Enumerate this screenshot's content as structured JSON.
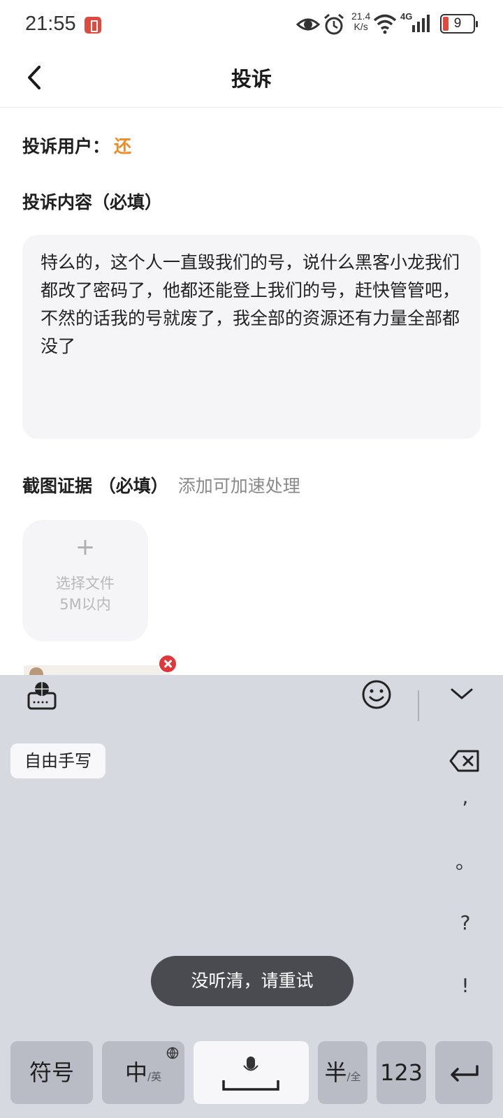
{
  "status_bar": {
    "time": "21:55",
    "net_speed_value": "21.4",
    "net_speed_unit": "K/s",
    "network": "4G",
    "battery_level": "9"
  },
  "nav": {
    "title": "投诉"
  },
  "form": {
    "user_label": "投诉用户：",
    "user_value": "还",
    "content_label": "投诉内容（必填）",
    "content_text": "特么的，这个人一直毁我们的号，说什么黑客小龙我们都改了密码了，他都还能登上我们的号，赶快管管吧，不然的话我的号就废了，我全部的资源还有力量全部都没了",
    "evidence_label": "截图证据 （必填）",
    "evidence_hint": "添加可加速处理",
    "upload_plus": "+",
    "upload_line1": "选择文件",
    "upload_line2": "5M以内"
  },
  "keyboard": {
    "handwrite_chip": "自由手写",
    "punctuation": [
      ",",
      "。",
      "?",
      "!"
    ],
    "toast": "没听清，请重试",
    "keys": {
      "symbol": "符号",
      "zh": "中",
      "zh_sub": "/英",
      "half": "半",
      "half_sub": "/全",
      "num": "123"
    }
  }
}
